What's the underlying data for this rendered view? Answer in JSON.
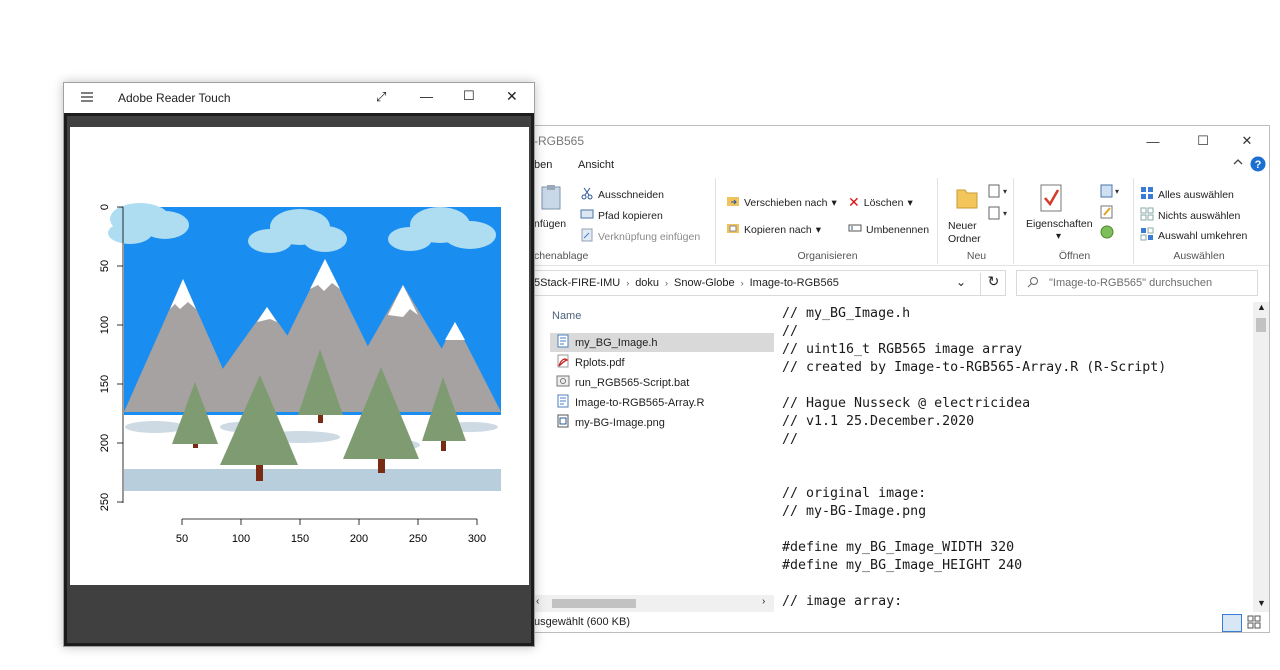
{
  "explorer": {
    "title": "-RGB565",
    "menu": [
      "ben",
      "Ansicht"
    ],
    "ribbon": {
      "clipboard": {
        "paste_label": "nfügen",
        "cut": "Ausschneiden",
        "copy_path": "Pfad kopieren",
        "paste_shortcut": "Verknüpfung einfügen",
        "group_label": "chenablage"
      },
      "organize": {
        "move_to": "Verschieben nach",
        "copy_to": "Kopieren nach",
        "delete": "Löschen",
        "rename": "Umbenennen",
        "group_label": "Organisieren"
      },
      "new": {
        "new_folder_line1": "Neuer",
        "new_folder_line2": "Ordner",
        "group_label": "Neu"
      },
      "open": {
        "properties": "Eigenschaften",
        "group_label": "Öffnen"
      },
      "select": {
        "select_all": "Alles auswählen",
        "select_none": "Nichts auswählen",
        "invert": "Auswahl umkehren",
        "group_label": "Auswählen"
      }
    },
    "breadcrumb": [
      "5Stack-FIRE-IMU",
      "doku",
      "Snow-Globe",
      "Image-to-RGB565"
    ],
    "search_placeholder": "\"Image-to-RGB565\" durchsuchen",
    "column_name": "Name",
    "files": [
      {
        "name": "my_BG_Image.h",
        "icon": "header-file-icon",
        "selected": true
      },
      {
        "name": "Rplots.pdf",
        "icon": "pdf-file-icon",
        "selected": false
      },
      {
        "name": "run_RGB565-Script.bat",
        "icon": "batch-file-icon",
        "selected": false
      },
      {
        "name": "Image-to-RGB565-Array.R",
        "icon": "r-file-icon",
        "selected": false
      },
      {
        "name": "my-BG-Image.png",
        "icon": "image-file-icon",
        "selected": false
      }
    ],
    "code_lines": [
      "// my_BG_Image.h",
      "//",
      "// uint16_t RGB565 image array",
      "// created by Image-to-RGB565-Array.R (R-Script)",
      "",
      "// Hague Nusseck @ electricidea",
      "// v1.1 25.December.2020",
      "//",
      "",
      "",
      "// original image:",
      "// my-BG-Image.png",
      "",
      "#define my_BG_Image_WIDTH 320",
      "#define my_BG_Image_HEIGHT 240",
      "",
      "// image array:"
    ],
    "status": "usgewählt (600 KB)"
  },
  "reader": {
    "title": "Adobe Reader Touch",
    "plot": {
      "x_ticks": [
        "50",
        "100",
        "150",
        "200",
        "250",
        "300"
      ],
      "y_ticks": [
        "0",
        "50",
        "100",
        "150",
        "200",
        "250"
      ]
    }
  }
}
